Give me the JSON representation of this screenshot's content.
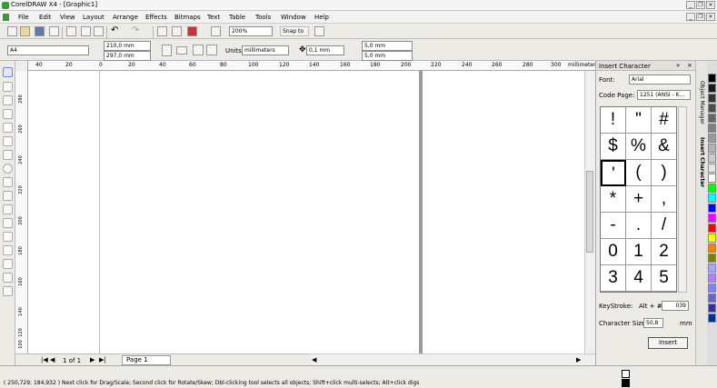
{
  "title": "CorelDRAW X4 - [Graphic1]",
  "menu": [
    "File",
    "Edit",
    "View",
    "Layout",
    "Arrange",
    "Effects",
    "Bitmaps",
    "Text",
    "Table",
    "Tools",
    "Window",
    "Help"
  ],
  "standard": {
    "zoom": "200%",
    "snap_to": "Snap to"
  },
  "property": {
    "paper": "A4",
    "width": "210,0 mm",
    "height": "297,0 mm",
    "units_label": "Units:",
    "units_value": "millimeters",
    "nudge": "0,1 mm",
    "dup_x": "5,0 mm",
    "dup_y": "5,0 mm"
  },
  "ruler_top": {
    "labels": [
      "40",
      "20",
      "0",
      "20",
      "40",
      "60",
      "80",
      "100",
      "120",
      "140",
      "160",
      "180",
      "200",
      "220",
      "240",
      "260",
      "280",
      "300"
    ],
    "unit": "millimeters"
  },
  "ruler_left": {
    "labels": [
      "280",
      "260",
      "240",
      "220",
      "200",
      "180",
      "160",
      "140",
      "120",
      "100"
    ],
    "unit": "millimeters"
  },
  "pagenav": {
    "count": "1 of 1",
    "page_tab": "Page 1"
  },
  "docker": {
    "title": "Insert Character",
    "font_label": "Font:",
    "font_value": "Arial",
    "codepage_label": "Code Page:",
    "codepage_value": "1251 (ANSI - K...",
    "chars": [
      "!",
      "\"",
      "#",
      "$",
      "%",
      "&",
      "'",
      "(",
      ")",
      "*",
      "+",
      ",",
      "-",
      ".",
      "/",
      "0",
      "1",
      "2",
      "3",
      "4",
      "5"
    ],
    "keystroke_label": "KeyStroke:",
    "keystroke_prefix": "Alt + #:",
    "keystroke_value": "039",
    "size_label": "Character Size:",
    "size_value": "50,8",
    "size_unit": "mm",
    "insert_button": "Insert",
    "tab_object_manager": "Object Manager",
    "tab_insert_character": "Insert Character"
  },
  "palette_colors": [
    "#000000",
    "#1a1a1a",
    "#333333",
    "#4d4d4d",
    "#666666",
    "#808080",
    "#999999",
    "#b3b3b3",
    "#cccccc",
    "#e6e6e6",
    "#ffffff",
    "#00ff00",
    "#00ffff",
    "#0000ff",
    "#ff00ff",
    "#ff0000",
    "#ffff00",
    "#ff8000",
    "#808000",
    "#a6a6ff",
    "#b280ff",
    "#8080ff",
    "#6666cc",
    "#333399",
    "#003399"
  ],
  "status": {
    "coords": "( 250,729; 184,932 )",
    "hint": "Next click for Drag/Scale; Second click for Rotate/Skew; Dbl-clicking tool selects all objects; Shift+click multi-selects; Alt+click digs"
  }
}
